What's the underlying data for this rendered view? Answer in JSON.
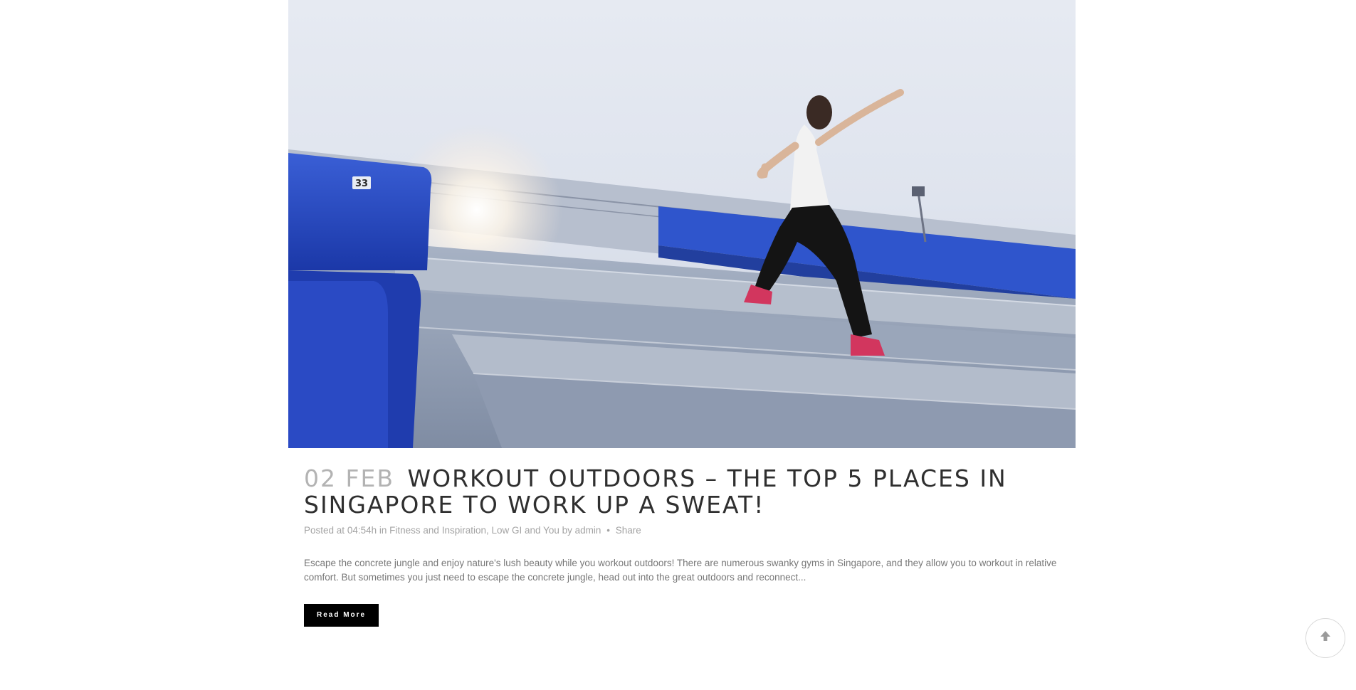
{
  "post": {
    "date_day": "02",
    "date_month": "FEB",
    "title": "Workout Outdoors – The Top 5 Places in Singapore to Work Up a Sweat!",
    "meta": {
      "posted_label": "Posted at",
      "time": "04:54h",
      "in_label": "in",
      "category_1": "Fitness and Inspiration",
      "category_2": "Low GI and You",
      "by_label": "by",
      "author": "admin",
      "separator": "•",
      "share_label": "Share"
    },
    "excerpt": "Escape the concrete jungle and enjoy nature's lush beauty while you workout outdoors! There are numerous swanky gyms in Singapore, and they allow you to workout in relative comfort. But sometimes you just need to escape the concrete jungle, head out into the great outdoors and reconnect...",
    "read_more_label": "Read More",
    "image": {
      "seat_number": "33"
    }
  },
  "back_to_top": {
    "icon": "arrow-up-icon"
  },
  "colors": {
    "title": "#2f2f2f",
    "date": "#b3b3b3",
    "meta": "#a3a3a3",
    "excerpt": "#777777",
    "button_bg": "#000000",
    "button_text": "#ffffff"
  }
}
